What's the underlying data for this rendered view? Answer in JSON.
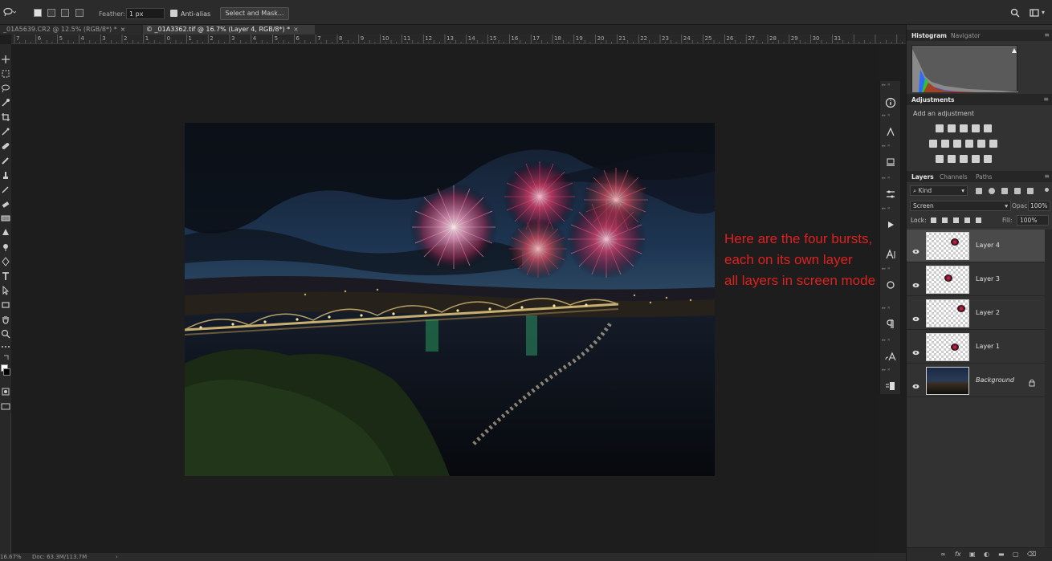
{
  "options_bar": {
    "tool_icon": "lasso-icon",
    "feather_label": "Feather:",
    "feather_value": "1 px",
    "anti_alias_label": "Anti-alias",
    "anti_alias_checked": true,
    "select_and_mask_label": "Select and Mask..."
  },
  "tabs": [
    {
      "label": "_01A5639.CR2 @ 12.5% (RGB/8*) *",
      "active": false
    },
    {
      "label": "© _01A3362.tif @ 16.7% (Layer 4, RGB/8*) *",
      "active": true
    }
  ],
  "ruler_labels": [
    "7",
    "6",
    "5",
    "4",
    "3",
    "2",
    "1",
    "0",
    "1",
    "2",
    "3",
    "4",
    "5",
    "6",
    "7",
    "8",
    "9",
    "10",
    "11",
    "12",
    "13",
    "14",
    "15",
    "16",
    "17",
    "18",
    "19",
    "20",
    "21",
    "22",
    "23",
    "24",
    "25",
    "26",
    "27",
    "28",
    "29",
    "30",
    "31"
  ],
  "status_bar": {
    "zoom": "16.67%",
    "doc": "Doc: 63.3M/113.7M"
  },
  "annotation": {
    "lines": [
      "Here are the four bursts,",
      "each on its own layer",
      "all layers in screen mode"
    ]
  },
  "panels": {
    "histogram_tabs": [
      "Histogram",
      "Navigator"
    ],
    "adjustments_title": "Adjustments",
    "adjustments_subtitle": "Add an adjustment",
    "layers_tabs": [
      "Layers",
      "Channels",
      "Paths"
    ],
    "filter_kind": "Kind",
    "blend_mode": "Screen",
    "opacity_label": "Opacity:",
    "opacity_value": "100%",
    "lock_label": "Lock:",
    "fill_label": "Fill:",
    "fill_value": "100%"
  },
  "layers": [
    {
      "name": "Layer 4",
      "selected": true
    },
    {
      "name": "Layer 3",
      "selected": false
    },
    {
      "name": "Layer 2",
      "selected": false
    },
    {
      "name": "Layer 1",
      "selected": false
    },
    {
      "name": "Background",
      "selected": false,
      "locked": true
    }
  ],
  "colors": {
    "annotation": "#e02020",
    "selected_layer": "#4a4a4a",
    "panel": "#323232"
  }
}
